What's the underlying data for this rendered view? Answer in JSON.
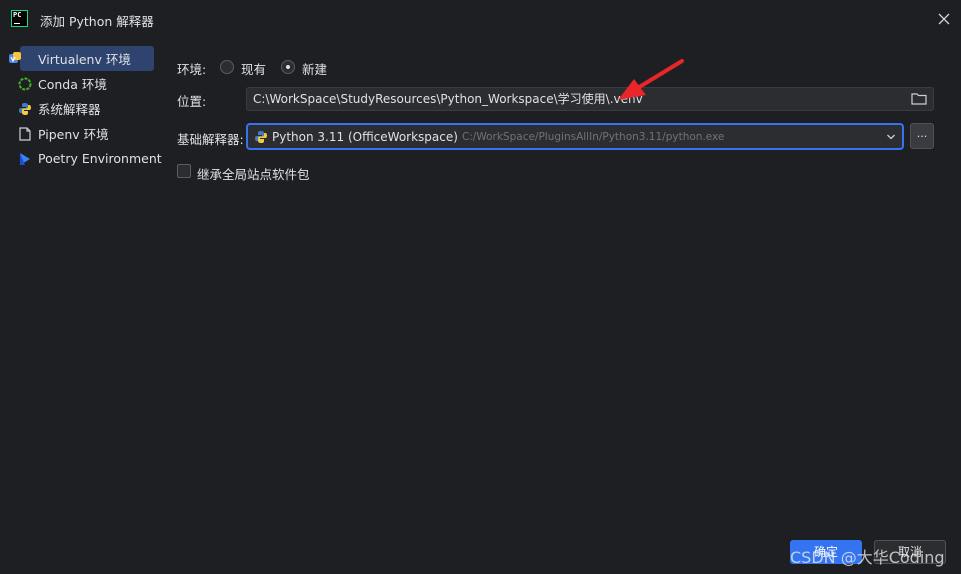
{
  "window": {
    "title": "添加 Python 解释器",
    "logo_text": "PC"
  },
  "sidebar": {
    "items": [
      {
        "label": "Virtualenv 环境",
        "icon": "virtualenv-icon",
        "selected": true
      },
      {
        "label": "Conda 环境",
        "icon": "conda-icon"
      },
      {
        "label": "系统解释器",
        "icon": "python-icon"
      },
      {
        "label": "Pipenv 环境",
        "icon": "pipenv-icon"
      },
      {
        "label": "Poetry Environment",
        "icon": "poetry-icon"
      }
    ]
  },
  "form": {
    "environment_label": "环境:",
    "option_existing": "现有",
    "option_new": "新建",
    "selected_option": "新建",
    "location_label": "位置:",
    "location_value": "C:\\WorkSpace\\StudyResources\\Python_Workspace\\学习使用\\.venv",
    "base_interpreter_label": "基础解释器:",
    "base_interpreter_name": "Python 3.11 (OfficeWorkspace)",
    "base_interpreter_path": "C:/WorkSpace/PluginsAllIn/Python3.11/python.exe",
    "more_button": "...",
    "inherit_label": "继承全局站点软件包",
    "inherit_checked": false
  },
  "buttons": {
    "ok": "确定",
    "cancel": "取消"
  },
  "watermark": "CSDN @大华Coding",
  "colors": {
    "background": "#1e1f22",
    "accent": "#3574f0",
    "selection": "#2e436e",
    "annotation_arrow": "#e8262a"
  }
}
